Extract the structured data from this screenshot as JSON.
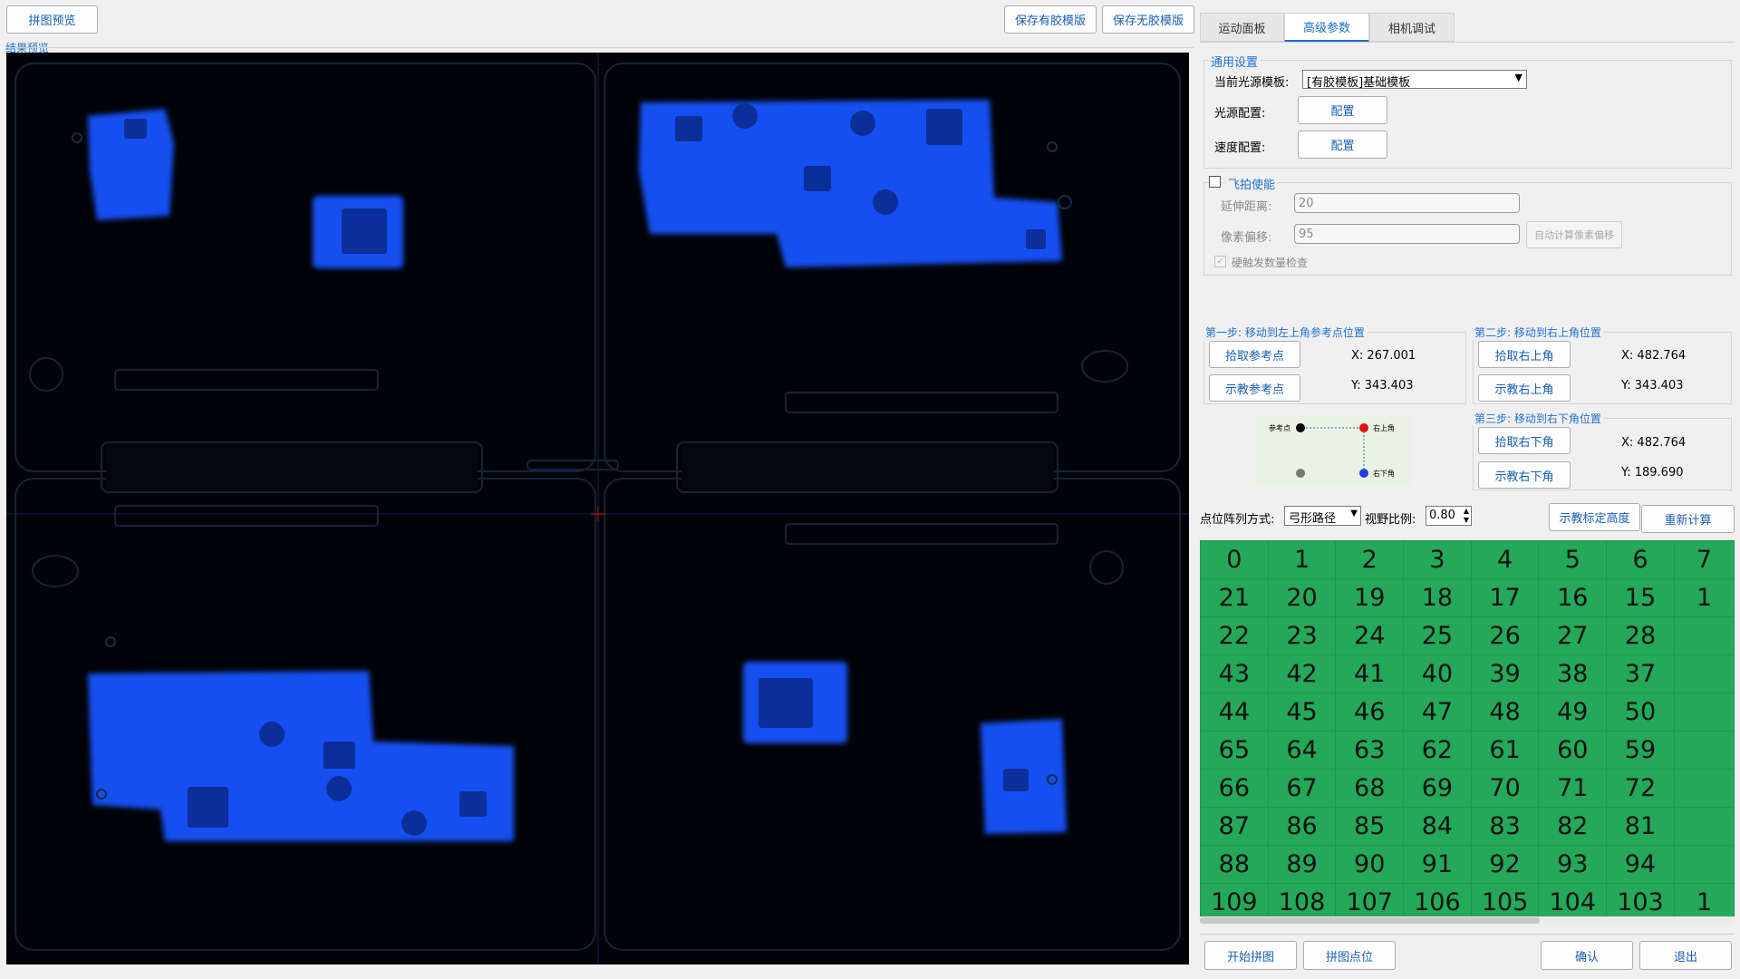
{
  "top_left_button": "拼图预览",
  "preview_label": "结果预览",
  "save_glue_button": "保存有胶模版",
  "save_noglue_button": "保存无胶模版",
  "tabs": [
    "运动面板",
    "高级参数",
    "相机调试"
  ],
  "general": {
    "title": "通用设置",
    "template_label": "当前光源模板:",
    "template_value": "[有胶模板]基础模板",
    "light_label": "光源配置:",
    "light_button": "配置",
    "speed_label": "速度配置:",
    "speed_button": "配置"
  },
  "fly": {
    "enable_label": "飞拍使能",
    "enabled": false,
    "extend_label": "延伸距离:",
    "extend_value": "20",
    "pixel_label": "像素偏移:",
    "pixel_value": "95",
    "auto_button": "自动计算像素偏移",
    "hw_check_label": "硬触发数量检查",
    "hw_checked": true
  },
  "step1": {
    "title": "第一步: 移动到左上角参考点位置",
    "pick_button": "拾取参考点",
    "teach_button": "示教参考点",
    "x": "X: 267.001",
    "y": "Y: 343.403"
  },
  "step2": {
    "title": "第二步: 移动到右上角位置",
    "pick_button": "拾取右上角",
    "teach_button": "示教右上角",
    "x": "X: 482.764",
    "y": "Y: 343.403"
  },
  "step3": {
    "title": "第三步: 移动到右下角位置",
    "pick_button": "拾取右下角",
    "teach_button": "示教右下角",
    "x": "X: 482.764",
    "y": "Y: 189.690"
  },
  "diagram": {
    "ref_label": "参考点",
    "tr_label": "右上角",
    "br_label": "右下角",
    "colors": {
      "ref": "#000000",
      "tr": "#e01010",
      "br": "#2040e0",
      "bl": "#777777"
    }
  },
  "array": {
    "mode_label": "点位阵列方式:",
    "mode_value": "弓形路径",
    "ratio_label": "视野比例:",
    "ratio_value": "0.80",
    "teach_height_button": "示教标定高度",
    "recalc_button": "重新计算"
  },
  "grid_rows": [
    [
      "0",
      "1",
      "2",
      "3",
      "4",
      "5",
      "6",
      "7"
    ],
    [
      "21",
      "20",
      "19",
      "18",
      "17",
      "16",
      "15",
      "1"
    ],
    [
      "22",
      "23",
      "24",
      "25",
      "26",
      "27",
      "28",
      ""
    ],
    [
      "43",
      "42",
      "41",
      "40",
      "39",
      "38",
      "37",
      ""
    ],
    [
      "44",
      "45",
      "46",
      "47",
      "48",
      "49",
      "50",
      ""
    ],
    [
      "65",
      "64",
      "63",
      "62",
      "61",
      "60",
      "59",
      ""
    ],
    [
      "66",
      "67",
      "68",
      "69",
      "70",
      "71",
      "72",
      ""
    ],
    [
      "87",
      "86",
      "85",
      "84",
      "83",
      "82",
      "81",
      ""
    ],
    [
      "88",
      "89",
      "90",
      "91",
      "92",
      "93",
      "94",
      ""
    ],
    [
      "109",
      "108",
      "107",
      "106",
      "105",
      "104",
      "103",
      "1"
    ]
  ],
  "bottom": {
    "start_button": "开始拼图",
    "stitch_button": "拼图点位",
    "ok_button": "确认",
    "exit_button": "退出"
  }
}
